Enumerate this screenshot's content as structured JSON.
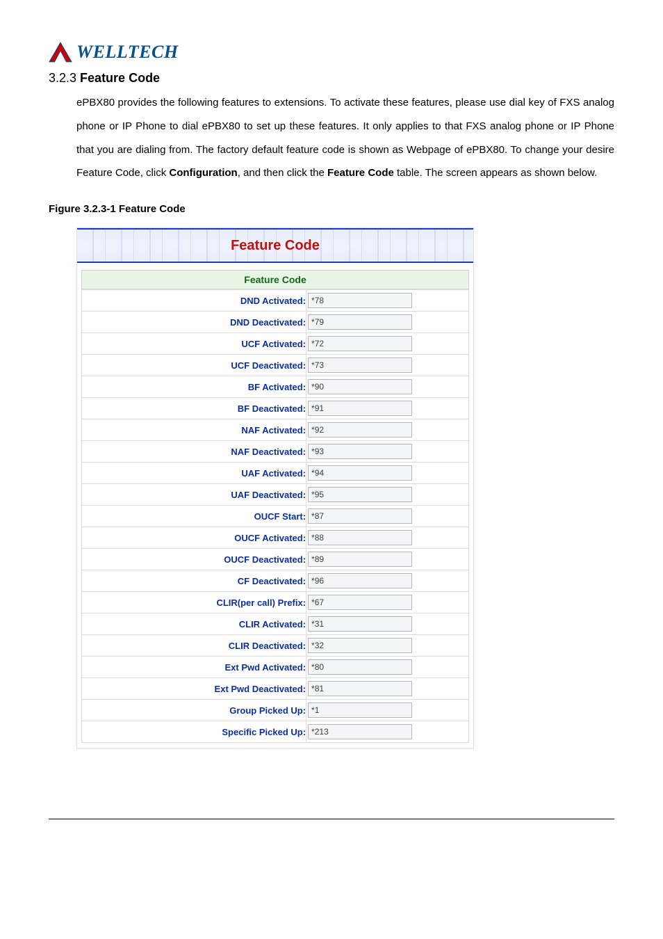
{
  "logo_text": "WELLTECH",
  "heading_number": "3.2.3 ",
  "heading_text": "Feature Code",
  "paragraph_parts": {
    "p1a": "ePBX80 provides the following features to extensions. To activate these features, please use dial key of FXS analog phone or IP Phone to dial ePBX80 to set up these features. It only applies to that FXS analog phone or IP Phone that you are dialing from. The factory default feature code is shown as Webpage of ePBX80. To change your desire Feature Code, click ",
    "p1b": "Configuration",
    "p1c": ", and then click the ",
    "p1d": "Feature Code",
    "p1e": " table. The screen appears as shown below."
  },
  "figure_label": "Figure   3.2.3-1 Feature Code",
  "panel": {
    "title": "Feature Code",
    "subtitle": "Feature Code",
    "rows": [
      {
        "label": "DND Activated:",
        "value": "*78"
      },
      {
        "label": "DND Deactivated:",
        "value": "*79"
      },
      {
        "label": "UCF Activated:",
        "value": "*72"
      },
      {
        "label": "UCF Deactivated:",
        "value": "*73"
      },
      {
        "label": "BF Activated:",
        "value": "*90"
      },
      {
        "label": "BF Deactivated:",
        "value": "*91"
      },
      {
        "label": "NAF Activated:",
        "value": "*92"
      },
      {
        "label": "NAF Deactivated:",
        "value": "*93"
      },
      {
        "label": "UAF Activated:",
        "value": "*94"
      },
      {
        "label": "UAF Deactivated:",
        "value": "*95"
      },
      {
        "label": "OUCF Start:",
        "value": "*87"
      },
      {
        "label": "OUCF Activated:",
        "value": "*88"
      },
      {
        "label": "OUCF Deactivated:",
        "value": "*89"
      },
      {
        "label": "CF Deactivated:",
        "value": "*96"
      },
      {
        "label": "CLIR(per call) Prefix:",
        "value": "*67"
      },
      {
        "label": "CLIR Activated:",
        "value": "*31"
      },
      {
        "label": "CLIR Deactivated:",
        "value": "*32"
      },
      {
        "label": "Ext Pwd Activated:",
        "value": "*80"
      },
      {
        "label": "Ext Pwd Deactivated:",
        "value": "*81"
      },
      {
        "label": "Group Picked Up:",
        "value": "*1"
      },
      {
        "label": "Specific Picked Up:",
        "value": "*213"
      }
    ]
  }
}
